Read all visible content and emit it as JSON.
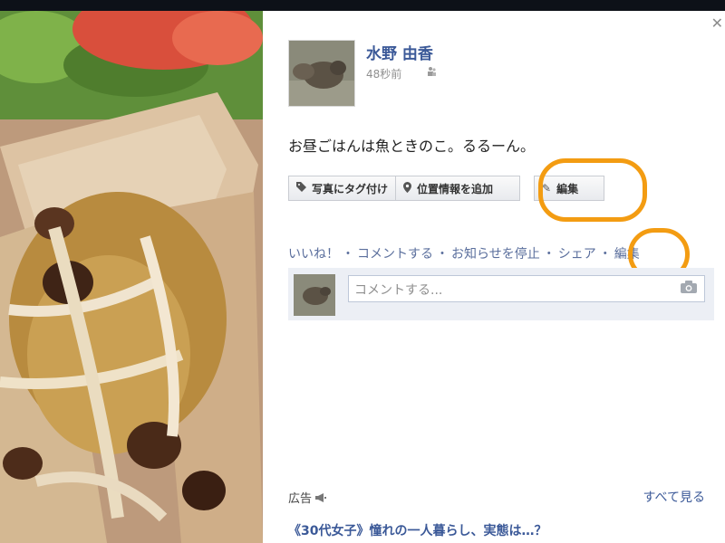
{
  "post": {
    "author": "水野 由香",
    "timestamp": "48秒前",
    "caption": "お昼ごはんは魚ときのこ。るるーん。"
  },
  "actions": {
    "tag_photo": "写真にタグ付け",
    "add_location": "位置情報を追加",
    "edit": "編集"
  },
  "links": {
    "like": "いいね！",
    "comment": "コメントする",
    "stop_notifications": "お知らせを停止",
    "share": "シェア",
    "edit": "編集",
    "separator": "・"
  },
  "comment": {
    "placeholder": "コメントする..."
  },
  "ads": {
    "label": "広告",
    "see_all": "すべて見る",
    "headline": "《30代女子》憧れの一人暮らし、実態は…？"
  },
  "icons": {
    "close": "close-icon",
    "privacy": "people-icon",
    "tag": "tag-icon",
    "location": "map-pin-icon",
    "edit": "pencil-icon",
    "camera": "camera-icon",
    "ad": "megaphone-icon"
  },
  "colors": {
    "link_blue": "#3b5998",
    "highlight_orange": "#f39c12"
  }
}
